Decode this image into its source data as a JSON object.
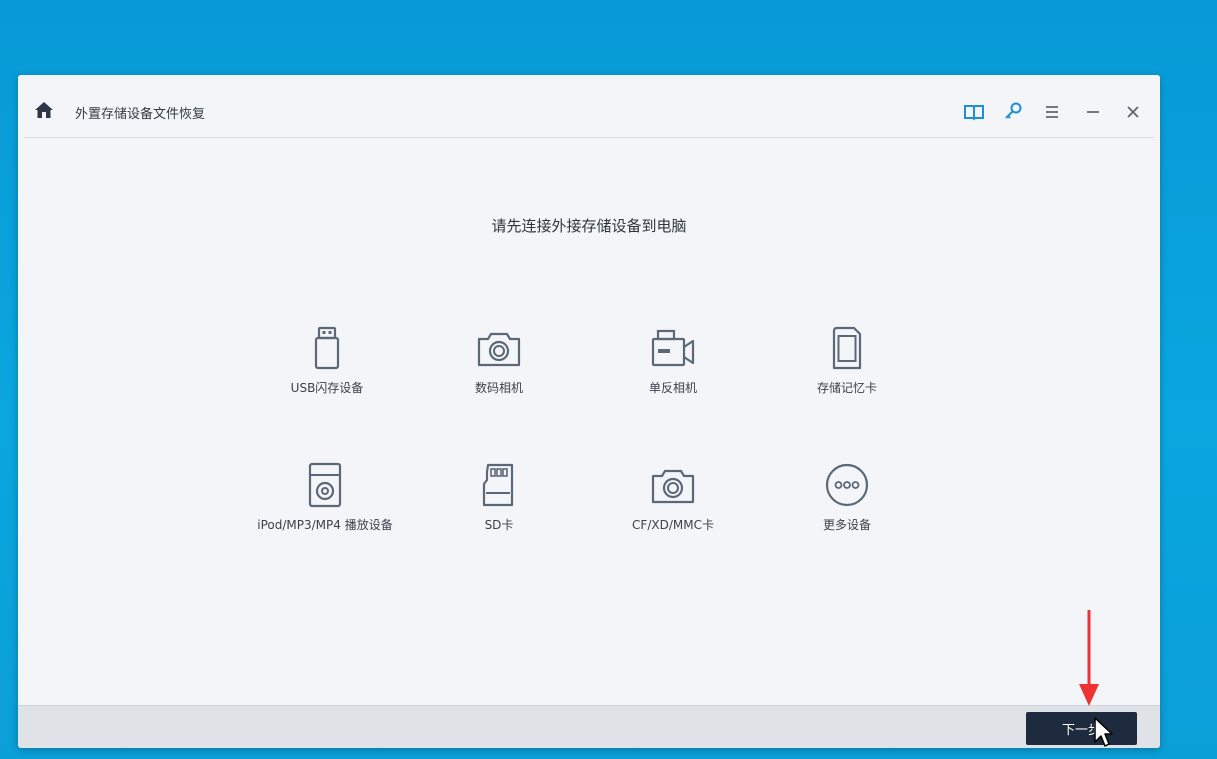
{
  "window": {
    "title": "外置存储设备文件恢复"
  },
  "toolbar": {
    "icons": [
      "home-icon",
      "book-icon",
      "key-icon",
      "menu-icon",
      "minimize-icon",
      "close-icon"
    ]
  },
  "main": {
    "headline": "请先连接外接存储设备到电脑",
    "devices": [
      {
        "label": "USB闪存设备",
        "icon": "usb-drive-icon"
      },
      {
        "label": "数码相机",
        "icon": "digital-camera-icon"
      },
      {
        "label": "单反相机",
        "icon": "video-camera-icon"
      },
      {
        "label": "存储记忆卡",
        "icon": "memory-card-icon"
      },
      {
        "label": "iPod/MP3/MP4 播放设备",
        "icon": "media-player-icon"
      },
      {
        "label": "SD卡",
        "icon": "sd-card-icon"
      },
      {
        "label": "CF/XD/MMC卡",
        "icon": "cf-card-camera-icon"
      },
      {
        "label": "更多设备",
        "icon": "more-devices-icon"
      }
    ]
  },
  "footer": {
    "next_label": "下一步"
  },
  "colors": {
    "desktop": "#0aa3dc",
    "window_bg": "#f4f5f8",
    "accent": "#1c8fd6",
    "icon_stroke": "#5b6878",
    "next_button": "#1e2b3e",
    "annotation_arrow": "#ee3333"
  }
}
